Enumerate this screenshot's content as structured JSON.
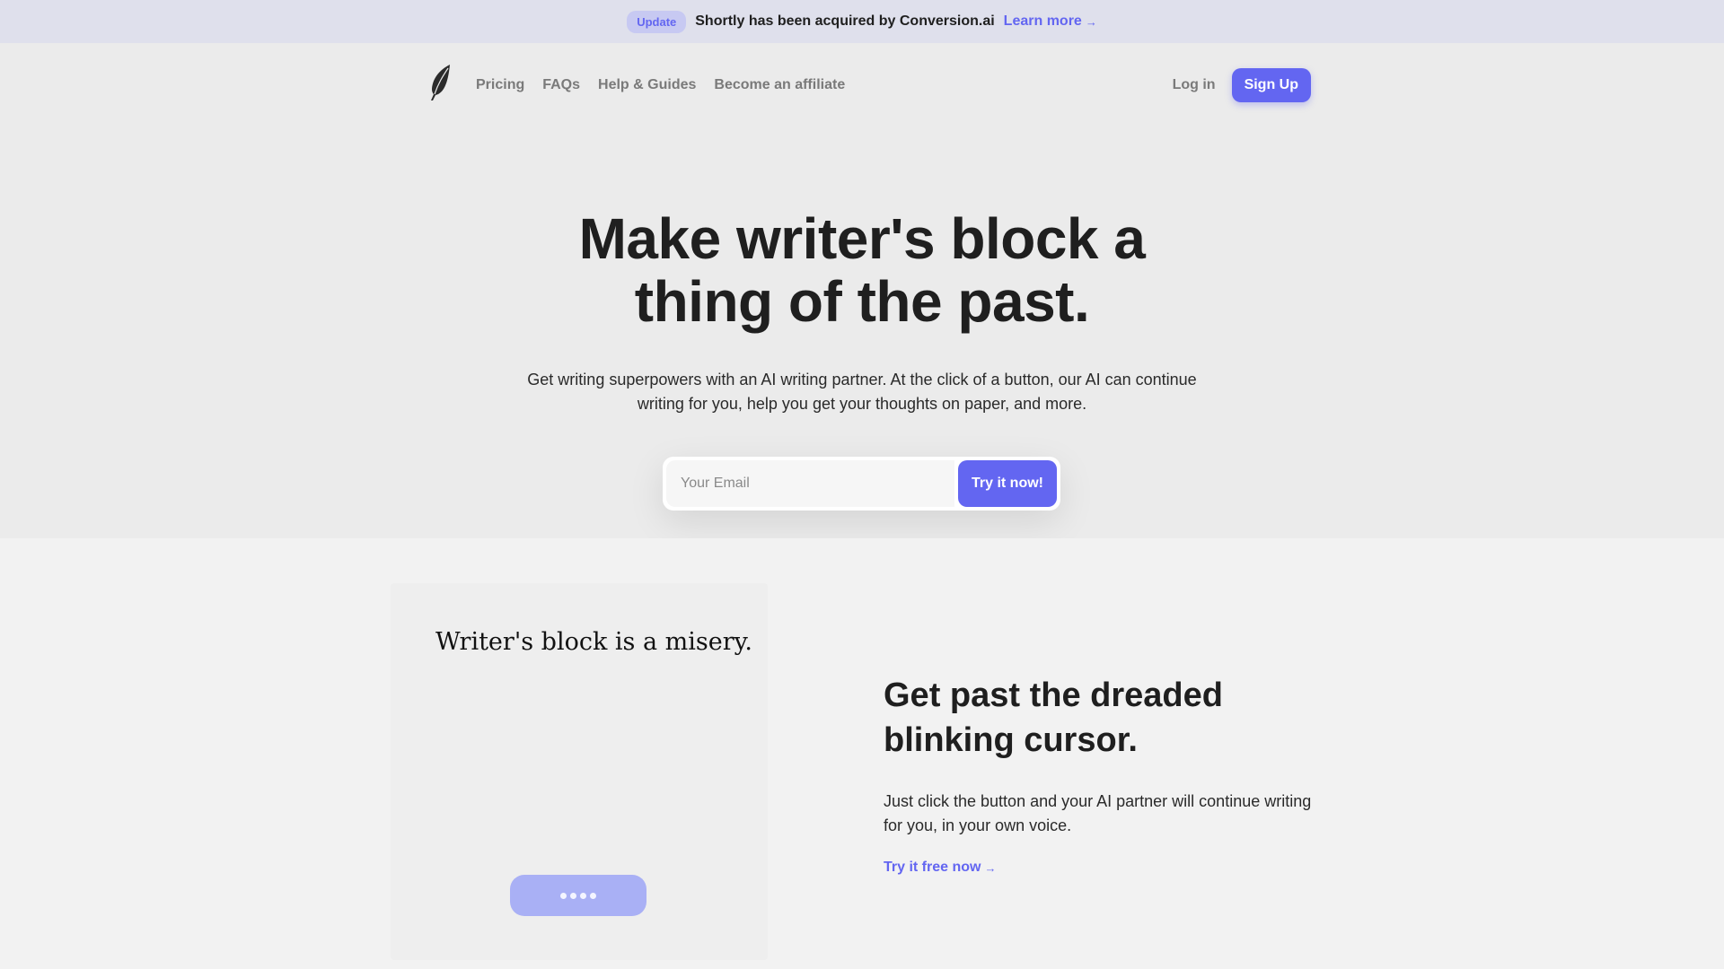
{
  "announcement": {
    "badge": "Update",
    "text": "Shortly has been acquired by Conversion.ai",
    "link_label": "Learn more",
    "link_arrow": "→"
  },
  "nav": {
    "logo_icon": "feather-icon",
    "links": [
      {
        "label": "Pricing"
      },
      {
        "label": "FAQs"
      },
      {
        "label": "Help & Guides"
      },
      {
        "label": "Become an affiliate"
      }
    ],
    "login_label": "Log in",
    "signup_label": "Sign Up"
  },
  "hero": {
    "title_line1": "Make writer's block a",
    "title_line2": "thing of the past.",
    "subtitle_line1": "Get writing superpowers with an AI writing partner. At the click of a button, our AI can continue",
    "subtitle_line2": "writing for you, help you get your thoughts on paper, and more.",
    "email_placeholder": "Your Email",
    "email_value": "",
    "cta_label": "Try it now!"
  },
  "feature": {
    "demo_text": "Writer's block is a misery.",
    "demo_button_icon": "loading-dots-icon",
    "title_line1": "Get past the dreaded",
    "title_line2": "blinking cursor.",
    "body_line1": "Just click the button and your AI partner will continue writing",
    "body_line2": "for you, in your own voice.",
    "link_label": "Try it free now",
    "link_arrow": "→"
  },
  "colors": {
    "accent": "#6366f1",
    "announcement_bg": "#dfe0ec",
    "hero_bg": "#ebebeb",
    "section_bg": "#f2f2f2",
    "demo_button": "#a9b0f5"
  }
}
